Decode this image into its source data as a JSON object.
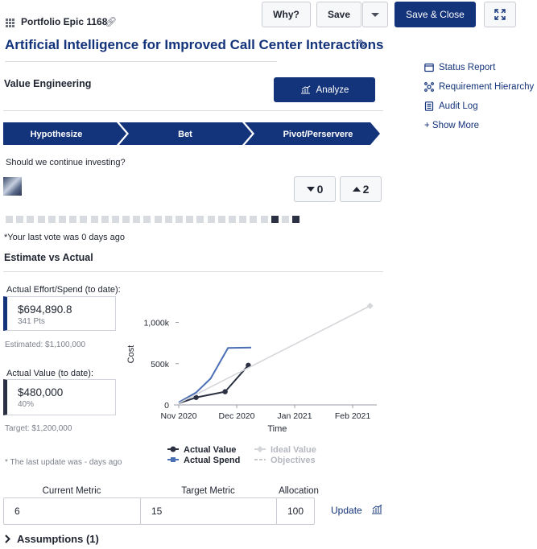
{
  "header": {
    "epic_id": "Portfolio Epic 1168",
    "title": "Artificial Intelligence for Improved Call Center Interactions",
    "why_label": "Why?",
    "save_label": "Save",
    "save_close_label": "Save & Close"
  },
  "side_links": [
    {
      "label": "Status Report",
      "icon": "status-report-icon"
    },
    {
      "label": "Requirement Hierarchy",
      "icon": "hierarchy-icon"
    },
    {
      "label": "Audit Log",
      "icon": "audit-log-icon"
    },
    {
      "label": "+ Show More",
      "icon": ""
    }
  ],
  "value_engineering": {
    "title": "Value Engineering",
    "analyze_label": "Analyze",
    "stages": [
      "Hypothesize",
      "Bet",
      "Pivot/Perservere"
    ],
    "question": "Should we continue investing?",
    "down_votes": "0",
    "up_votes": "2",
    "vote_dots": [
      false,
      false,
      false,
      false,
      false,
      false,
      false,
      false,
      false,
      false,
      false,
      false,
      false,
      false,
      false,
      false,
      false,
      false,
      false,
      false,
      false,
      false,
      false,
      false,
      false,
      true,
      false,
      true
    ],
    "last_vote": "*Your last vote was 0 days ago"
  },
  "estimate": {
    "title": "Estimate vs Actual",
    "effort_label": "Actual Effort/Spend (to date):",
    "effort_value": "$694,890.8",
    "effort_points": "341 Pts",
    "estimated": "Estimated: $1,100,000",
    "value_label": "Actual Value (to date):",
    "value_value": "$480,000",
    "value_pct": "40%",
    "target": "Target: $1,200,000",
    "last_update_note": "* The last update was - days ago"
  },
  "chart_data": {
    "type": "line",
    "xlabel": "Time",
    "ylabel": "Cost",
    "x_ticks": [
      "Nov 2020",
      "Dec 2020",
      "Jan 2021",
      "Feb 2021"
    ],
    "y_ticks": [
      "0",
      "500k",
      "1,000k"
    ],
    "ylim": [
      0,
      1200000
    ],
    "series": [
      {
        "name": "Actual Value",
        "color": "#2b3142",
        "marker": "dot",
        "points": [
          [
            0,
            20000
          ],
          [
            0.3,
            90000
          ],
          [
            0.8,
            160000
          ],
          [
            1.2,
            480000
          ]
        ]
      },
      {
        "name": "Actual Spend",
        "color": "#4a6fb5",
        "marker": "none",
        "points": [
          [
            0,
            30000
          ],
          [
            0.3,
            150000
          ],
          [
            0.55,
            320000
          ],
          [
            0.85,
            690000
          ],
          [
            1.25,
            694890
          ]
        ]
      },
      {
        "name": "Ideal Value",
        "color": "#d4d6da",
        "marker": "diamond",
        "points": [
          [
            0,
            20000
          ],
          [
            3.3,
            1200000
          ]
        ]
      },
      {
        "name": "Objectives",
        "color": "#c8cad0",
        "marker": "none",
        "points": []
      }
    ]
  },
  "metrics": {
    "current_label": "Current Metric",
    "target_label": "Target Metric",
    "allocation_label": "Allocation",
    "current_value": "6",
    "target_value": "15",
    "allocation_value": "100",
    "update_label": "Update"
  },
  "assumptions_label": "Assumptions (1)",
  "colors": {
    "brand": "#13337a",
    "accent": "#4a6fb5",
    "dark": "#2b3142"
  }
}
